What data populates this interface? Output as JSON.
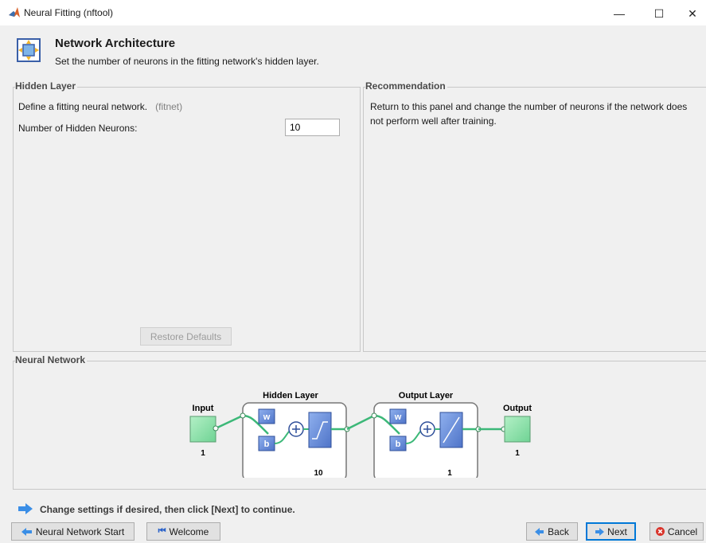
{
  "window": {
    "title": "Neural Fitting (nftool)",
    "minimize_glyph": "—",
    "maximize_glyph": "☐",
    "close_glyph": "✕"
  },
  "header": {
    "title": "Network Architecture",
    "subtitle": "Set the number of neurons in the fitting network's hidden layer.",
    "icon": "network-architecture-icon"
  },
  "hidden_layer": {
    "title": "Hidden Layer",
    "description": "Define a fitting neural network.",
    "function": "(fitnet)",
    "neurons_label": "Number of Hidden Neurons:",
    "neurons_value": "10",
    "restore_button": "Restore Defaults"
  },
  "recommendation": {
    "title": "Recommendation",
    "text_line1": "Return to this panel and change the number of neurons if the network does",
    "text_line2": "not perform well after training."
  },
  "neural_network": {
    "title": "Neural Network",
    "input_label": "Input",
    "input_size": "1",
    "hidden_label": "Hidden Layer",
    "hidden_size": "10",
    "output_layer_label": "Output Layer",
    "output_layer_size": "1",
    "output_label": "Output",
    "output_size": "1",
    "weight_symbol": "w",
    "bias_symbol": "b"
  },
  "hint": {
    "text": "Change settings  if desired, then click [Next] to continue.",
    "icon": "arrow-right-icon"
  },
  "buttons": {
    "nn_start": "Neural Network Start",
    "welcome": "Welcome",
    "back": "Back",
    "next": "Next",
    "cancel": "Cancel"
  },
  "colors": {
    "green_box": "#8ee0a8",
    "blue_box": "#6d8fd6",
    "connector": "#3cb878",
    "matlab_orange": "#d9622b",
    "hint_arrow": "#3a8ee6",
    "cancel_red": "#d9342b"
  }
}
